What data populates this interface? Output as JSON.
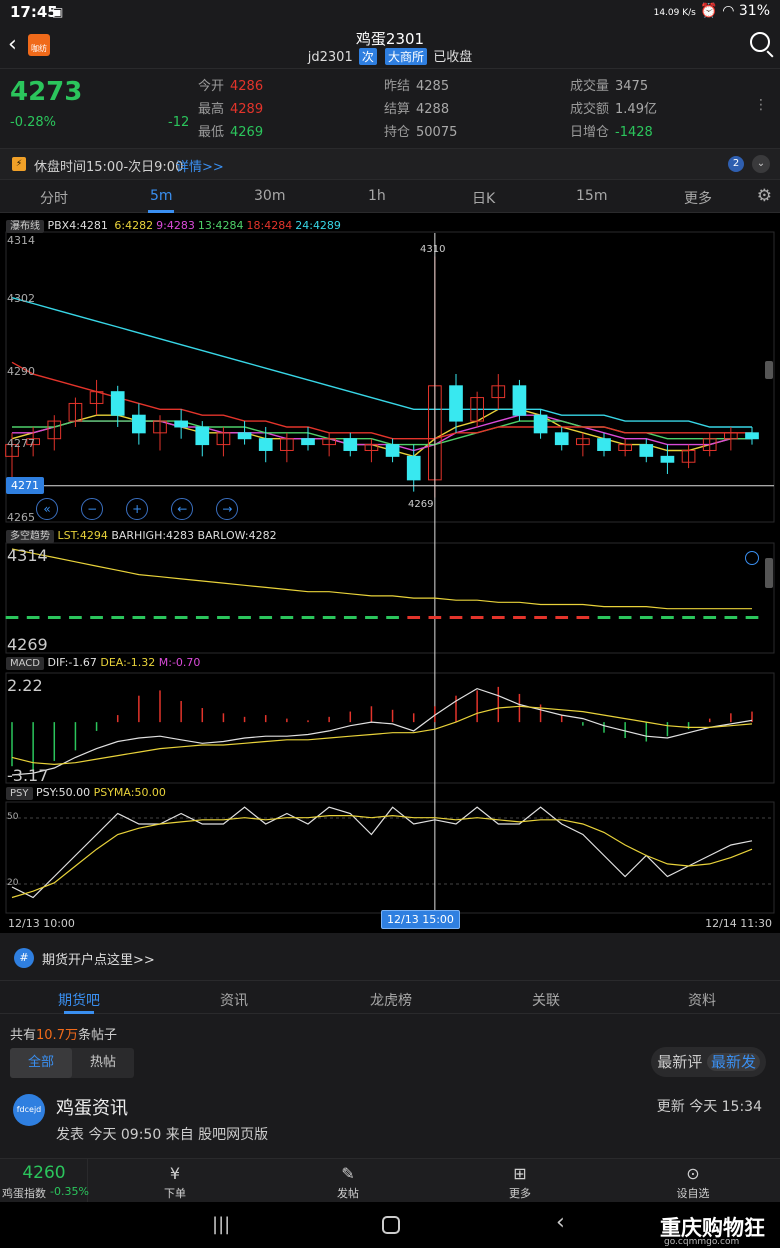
{
  "status": {
    "time": "17:45",
    "net_speed": "14.09 K/s",
    "battery": "31%"
  },
  "header": {
    "badge": "咖纺",
    "title": "鸡蛋2301",
    "code": "jd2301",
    "tag_next": "次",
    "tag_exchange": "大商所",
    "state": "已收盘"
  },
  "quote": {
    "price": "4273",
    "pct": "-0.28%",
    "change": "-12",
    "rows": [
      [
        {
          "k": "今开",
          "v": "4286",
          "c": "red"
        },
        {
          "k": "昨结",
          "v": "4285",
          "c": "gray"
        },
        {
          "k": "成交量",
          "v": "3475",
          "c": "gray"
        }
      ],
      [
        {
          "k": "最高",
          "v": "4289",
          "c": "red"
        },
        {
          "k": "结算",
          "v": "4288",
          "c": "gray"
        },
        {
          "k": "成交额",
          "v": "1.49亿",
          "c": "gray"
        }
      ],
      [
        {
          "k": "最低",
          "v": "4269",
          "c": "green"
        },
        {
          "k": "持仓",
          "v": "50075",
          "c": "gray"
        },
        {
          "k": "日增仓",
          "v": "-1428",
          "c": "green"
        }
      ]
    ]
  },
  "notice": {
    "text": "休盘时间15:00-次日9:00",
    "link": "详情>>",
    "count": "2"
  },
  "periods": [
    "分时",
    "5m",
    "30m",
    "1h",
    "日K",
    "15m",
    "更多"
  ],
  "active_period": "5m",
  "indicators": {
    "main": {
      "button": "瀑布线",
      "label": "PBX4:4281",
      "items": [
        {
          "t": "6:4282",
          "c": "#e8d23a"
        },
        {
          "t": "9:4283",
          "c": "#d94bd8"
        },
        {
          "t": "13:4284",
          "c": "#4fd06a"
        },
        {
          "t": "18:4284",
          "c": "#e3342b"
        },
        {
          "t": "24:4289",
          "c": "#38d6e6"
        }
      ]
    },
    "trend": {
      "button": "多空趋势",
      "lst": "LST:4294",
      "rest": "BARHIGH:4283 BARLOW:4282"
    },
    "macd": {
      "button": "MACD",
      "dif": "DIF:-1.67",
      "dea": "DEA:-1.32",
      "m": "M:-0.70"
    },
    "psy": {
      "button": "PSY",
      "psy": "PSY:50.00",
      "psyma": "PSYMA:50.00"
    }
  },
  "axis": {
    "main_ticks": [
      "4314",
      "4302",
      "4290",
      "4277",
      "4265"
    ],
    "current_price": "4271",
    "hi_mark": "4310",
    "lo_mark": "4269",
    "trend_top": "4314",
    "trend_bottom": "4269",
    "macd_top": "2.22",
    "macd_bottom": "-3.17",
    "psy_top": "50",
    "psy_bottom": "20",
    "time_start": "12/13 10:00",
    "time_cursor": "12/13 15:00",
    "time_end": "12/14 11:30"
  },
  "promo": {
    "text": "期货开户点这里>>"
  },
  "sections": [
    "期货吧",
    "资讯",
    "龙虎榜",
    "关联",
    "资料"
  ],
  "active_section": "期货吧",
  "posts": {
    "count_prefix": "共有",
    "count": "10.7万",
    "count_suffix": "条帖子",
    "filters": [
      "全部",
      "热帖"
    ],
    "sort_reply": "最新评",
    "sort_post": "最新发",
    "item": {
      "avatar": "fdcejd",
      "title": "鸡蛋资讯",
      "meta": "发表 今天 09:50 来自 股吧网页版",
      "updated": "更新 今天 15:34"
    }
  },
  "bottom": {
    "index_price": "4260",
    "index_name": "鸡蛋指数",
    "index_pct": "-0.35%",
    "nav": [
      "下单",
      "发帖",
      "更多",
      "设自选"
    ]
  },
  "watermark": {
    "name": "重庆购物狂",
    "url": "go.cqmmgo.com"
  },
  "chart_data": [
    {
      "type": "candlestick",
      "x": [
        "12/13 10:00",
        "12/13 15:00",
        "12/14 11:30"
      ],
      "ylim": [
        4265,
        4314
      ],
      "y_ticks": [
        4314,
        4302,
        4290,
        4277,
        4265
      ],
      "ohlc": [
        [
          4276,
          4280,
          4272,
          4278
        ],
        [
          4278,
          4281,
          4276,
          4279
        ],
        [
          4279,
          4283,
          4277,
          4282
        ],
        [
          4282,
          4286,
          4281,
          4285
        ],
        [
          4285,
          4289,
          4283,
          4287
        ],
        [
          4287,
          4288,
          4281,
          4283
        ],
        [
          4283,
          4285,
          4278,
          4280
        ],
        [
          4280,
          4283,
          4277,
          4282
        ],
        [
          4282,
          4284,
          4279,
          4281
        ],
        [
          4281,
          4282,
          4276,
          4278
        ],
        [
          4278,
          4281,
          4276,
          4280
        ],
        [
          4280,
          4282,
          4278,
          4279
        ],
        [
          4279,
          4281,
          4275,
          4277
        ],
        [
          4277,
          4280,
          4275,
          4279
        ],
        [
          4279,
          4281,
          4277,
          4278
        ],
        [
          4278,
          4280,
          4276,
          4279
        ],
        [
          4279,
          4280,
          4276,
          4277
        ],
        [
          4277,
          4279,
          4275,
          4278
        ],
        [
          4278,
          4279,
          4275,
          4276
        ],
        [
          4276,
          4278,
          4270,
          4272
        ],
        [
          4272,
          4310,
          4269,
          4288
        ],
        [
          4288,
          4290,
          4280,
          4282
        ],
        [
          4282,
          4287,
          4281,
          4286
        ],
        [
          4286,
          4290,
          4284,
          4288
        ],
        [
          4288,
          4289,
          4282,
          4283
        ],
        [
          4283,
          4284,
          4279,
          4280
        ],
        [
          4280,
          4281,
          4277,
          4278
        ],
        [
          4278,
          4280,
          4276,
          4279
        ],
        [
          4279,
          4280,
          4276,
          4277
        ],
        [
          4277,
          4279,
          4276,
          4278
        ],
        [
          4278,
          4279,
          4275,
          4276
        ],
        [
          4276,
          4278,
          4273,
          4275
        ],
        [
          4275,
          4278,
          4274,
          4277
        ],
        [
          4277,
          4280,
          4276,
          4279
        ],
        [
          4279,
          4281,
          4277,
          4280
        ],
        [
          4280,
          4281,
          4278,
          4279
        ]
      ],
      "series": [
        {
          "name": "6",
          "color": "#e8d23a",
          "values": [
            4279,
            4280,
            4281,
            4282,
            4283,
            4283,
            4282,
            4282,
            4281,
            4280,
            4280,
            4280,
            4279,
            4279,
            4279,
            4279,
            4278,
            4278,
            4277,
            4276,
            4279,
            4281,
            4282,
            4284,
            4284,
            4283,
            4281,
            4280,
            4279,
            4278,
            4278,
            4277,
            4277,
            4278,
            4279,
            4279
          ]
        },
        {
          "name": "9",
          "color": "#d94bd8",
          "values": [
            4280,
            4280,
            4281,
            4282,
            4282,
            4282,
            4282,
            4282,
            4281,
            4281,
            4280,
            4280,
            4280,
            4279,
            4279,
            4279,
            4278,
            4278,
            4278,
            4277,
            4278,
            4280,
            4281,
            4282,
            4283,
            4283,
            4282,
            4281,
            4280,
            4279,
            4279,
            4278,
            4278,
            4278,
            4279,
            4279
          ]
        },
        {
          "name": "13",
          "color": "#4fd06a",
          "values": [
            4281,
            4281,
            4281,
            4282,
            4282,
            4282,
            4282,
            4282,
            4282,
            4281,
            4281,
            4281,
            4280,
            4280,
            4280,
            4279,
            4279,
            4279,
            4278,
            4278,
            4278,
            4279,
            4280,
            4281,
            4282,
            4282,
            4282,
            4281,
            4281,
            4280,
            4280,
            4279,
            4279,
            4279,
            4279,
            4279
          ]
        },
        {
          "name": "18",
          "color": "#e3342b",
          "values": [
            4292,
            4290,
            4289,
            4288,
            4287,
            4286,
            4285,
            4284,
            4284,
            4283,
            4283,
            4282,
            4282,
            4281,
            4281,
            4280,
            4280,
            4280,
            4279,
            4279,
            4279,
            4280,
            4280,
            4281,
            4281,
            4281,
            4281,
            4281,
            4281,
            4280,
            4280,
            4280,
            4280,
            4280,
            4280,
            4280
          ]
        },
        {
          "name": "24",
          "color": "#38d6e6",
          "values": [
            4303,
            4302,
            4301,
            4300,
            4299,
            4298,
            4297,
            4296,
            4295,
            4294,
            4293,
            4292,
            4291,
            4290,
            4289,
            4288,
            4287,
            4286,
            4285,
            4284,
            4284,
            4284,
            4284,
            4284,
            4284,
            4284,
            4283,
            4283,
            4283,
            4282,
            4282,
            4282,
            4282,
            4281,
            4281,
            4281
          ]
        }
      ]
    },
    {
      "type": "line",
      "name": "trend",
      "ylim": [
        4269,
        4314
      ],
      "series": [
        {
          "name": "LST",
          "color": "#e8d23a",
          "values": [
            4314,
            4312,
            4310,
            4308,
            4306,
            4304,
            4302,
            4301,
            4300,
            4299,
            4298,
            4297,
            4296,
            4295,
            4294,
            4294,
            4293,
            4292,
            4292,
            4291,
            4291,
            4290,
            4290,
            4289,
            4289,
            4288,
            4288,
            4288,
            4287,
            4287,
            4287,
            4286,
            4286,
            4286,
            4286,
            4286
          ]
        }
      ]
    },
    {
      "type": "bar",
      "name": "MACD",
      "ylim": [
        -3.17,
        2.22
      ],
      "values": [
        -2.5,
        -2.8,
        -2.2,
        -1.6,
        -0.5,
        0.4,
        1.5,
        1.8,
        1.2,
        0.8,
        0.5,
        0.3,
        0.4,
        0.2,
        0.1,
        0.3,
        0.6,
        0.9,
        0.7,
        0.5,
        0.9,
        1.5,
        1.8,
        2.0,
        1.6,
        1.0,
        0.4,
        -0.2,
        -0.6,
        -0.9,
        -1.1,
        -0.8,
        -0.4,
        0.2,
        0.5,
        0.6
      ],
      "series": [
        {
          "name": "DIF",
          "color": "#e0e0e0",
          "values": [
            -3.0,
            -2.9,
            -2.6,
            -2.0,
            -1.5,
            -1.1,
            -0.9,
            -0.8,
            -1.0,
            -1.2,
            -1.1,
            -0.9,
            -0.8,
            -0.8,
            -0.7,
            -0.5,
            -0.2,
            0.0,
            -0.1,
            -0.5,
            0.4,
            1.2,
            1.9,
            1.5,
            1.0,
            0.7,
            0.4,
            0.2,
            -0.2,
            -0.5,
            -0.8,
            -0.9,
            -0.6,
            -0.3,
            -0.1,
            0.1
          ]
        },
        {
          "name": "DEA",
          "color": "#e8d23a",
          "values": [
            -2.0,
            -2.3,
            -2.4,
            -2.3,
            -2.1,
            -1.9,
            -1.7,
            -1.5,
            -1.4,
            -1.3,
            -1.3,
            -1.2,
            -1.1,
            -1.0,
            -1.0,
            -0.9,
            -0.8,
            -0.7,
            -0.6,
            -0.6,
            -0.4,
            0.0,
            0.5,
            0.8,
            0.9,
            0.8,
            0.7,
            0.6,
            0.4,
            0.2,
            0.0,
            -0.2,
            -0.3,
            -0.3,
            -0.2,
            -0.1
          ]
        }
      ]
    },
    {
      "type": "line",
      "name": "PSY",
      "ylim": [
        10,
        60
      ],
      "series": [
        {
          "name": "PSY",
          "color": "#e0e0e0",
          "values": [
            20,
            15,
            25,
            35,
            45,
            55,
            50,
            50,
            55,
            50,
            50,
            58,
            50,
            55,
            50,
            58,
            55,
            45,
            58,
            50,
            52,
            50,
            58,
            50,
            50,
            58,
            50,
            45,
            35,
            25,
            35,
            25,
            30,
            35,
            40,
            42
          ]
        },
        {
          "name": "PSYMA",
          "color": "#e8d23a",
          "values": [
            15,
            18,
            22,
            30,
            38,
            45,
            48,
            50,
            51,
            52,
            52,
            53,
            52,
            53,
            53,
            54,
            54,
            53,
            54,
            53,
            53,
            52,
            53,
            52,
            51,
            52,
            52,
            50,
            46,
            40,
            35,
            31,
            30,
            31,
            34,
            38
          ]
        }
      ]
    }
  ]
}
